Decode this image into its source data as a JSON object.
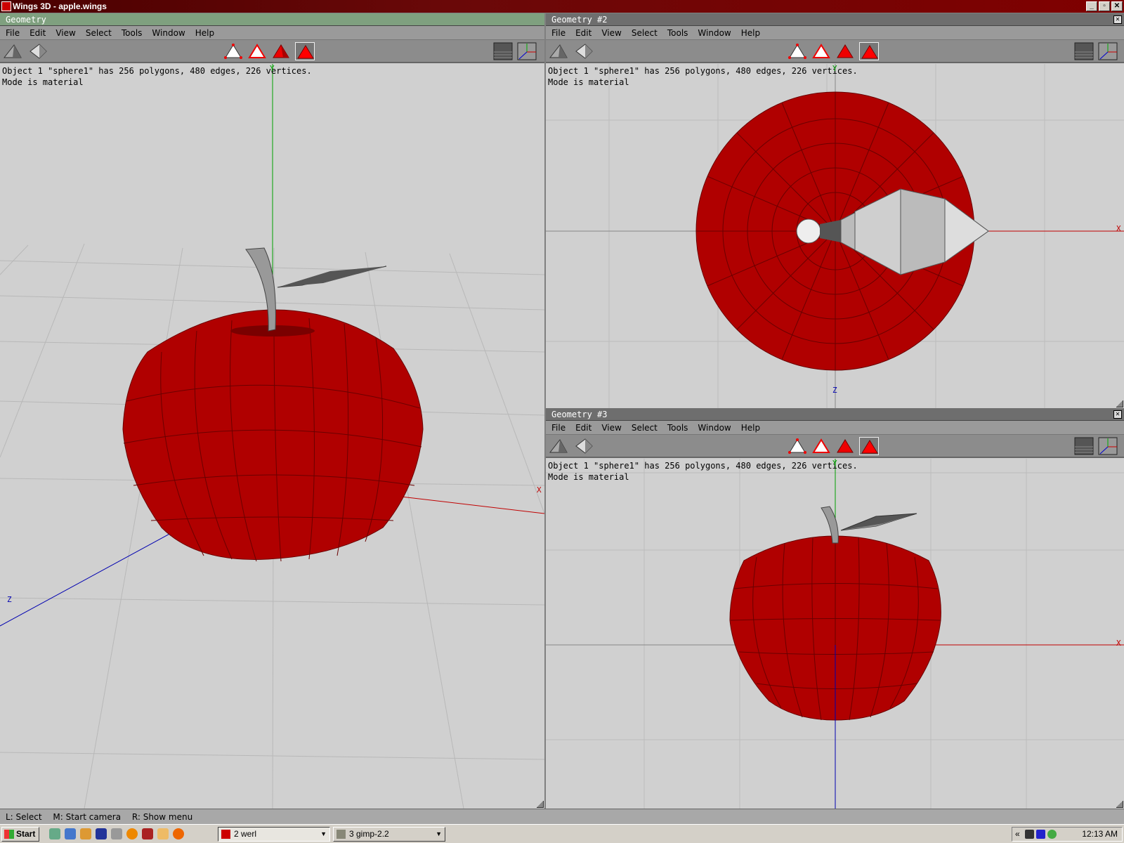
{
  "window": {
    "title": "Wings 3D - apple.wings",
    "min": "_",
    "max": "▫",
    "close": "✕"
  },
  "menu": [
    "File",
    "Edit",
    "View",
    "Select",
    "Tools",
    "Window",
    "Help"
  ],
  "panes": [
    {
      "title": "Geometry"
    },
    {
      "title": "Geometry #2"
    },
    {
      "title": "Geometry #3"
    }
  ],
  "info": {
    "line1": "Object 1 \"sphere1\" has 256 polygons, 480 edges, 226 vertices.",
    "line2": "Mode is material"
  },
  "axes": {
    "x": "X",
    "y": "Y",
    "z": "Z"
  },
  "status": {
    "left": "L: Select",
    "middle": "M: Start camera",
    "right": "R: Show menu"
  },
  "taskbar": {
    "start": "Start",
    "tasks": [
      {
        "label": "2 werl"
      },
      {
        "label": "3 gimp-2.2"
      }
    ],
    "tray_arrow": "«",
    "clock": "12:13 AM"
  },
  "colors": {
    "apple": "#b00000",
    "xaxis": "#c00000",
    "yaxis": "#00a000",
    "zaxis": "#0000b0",
    "active_title": "#7fa07f"
  },
  "icons": {
    "toolbar": [
      "vertex-select-icon",
      "edge-select-icon",
      "face-select-icon",
      "body-select-icon",
      "face-mode-icon",
      "object-mode-icon",
      "groundplane-icon",
      "axes-toggle-icon"
    ]
  }
}
